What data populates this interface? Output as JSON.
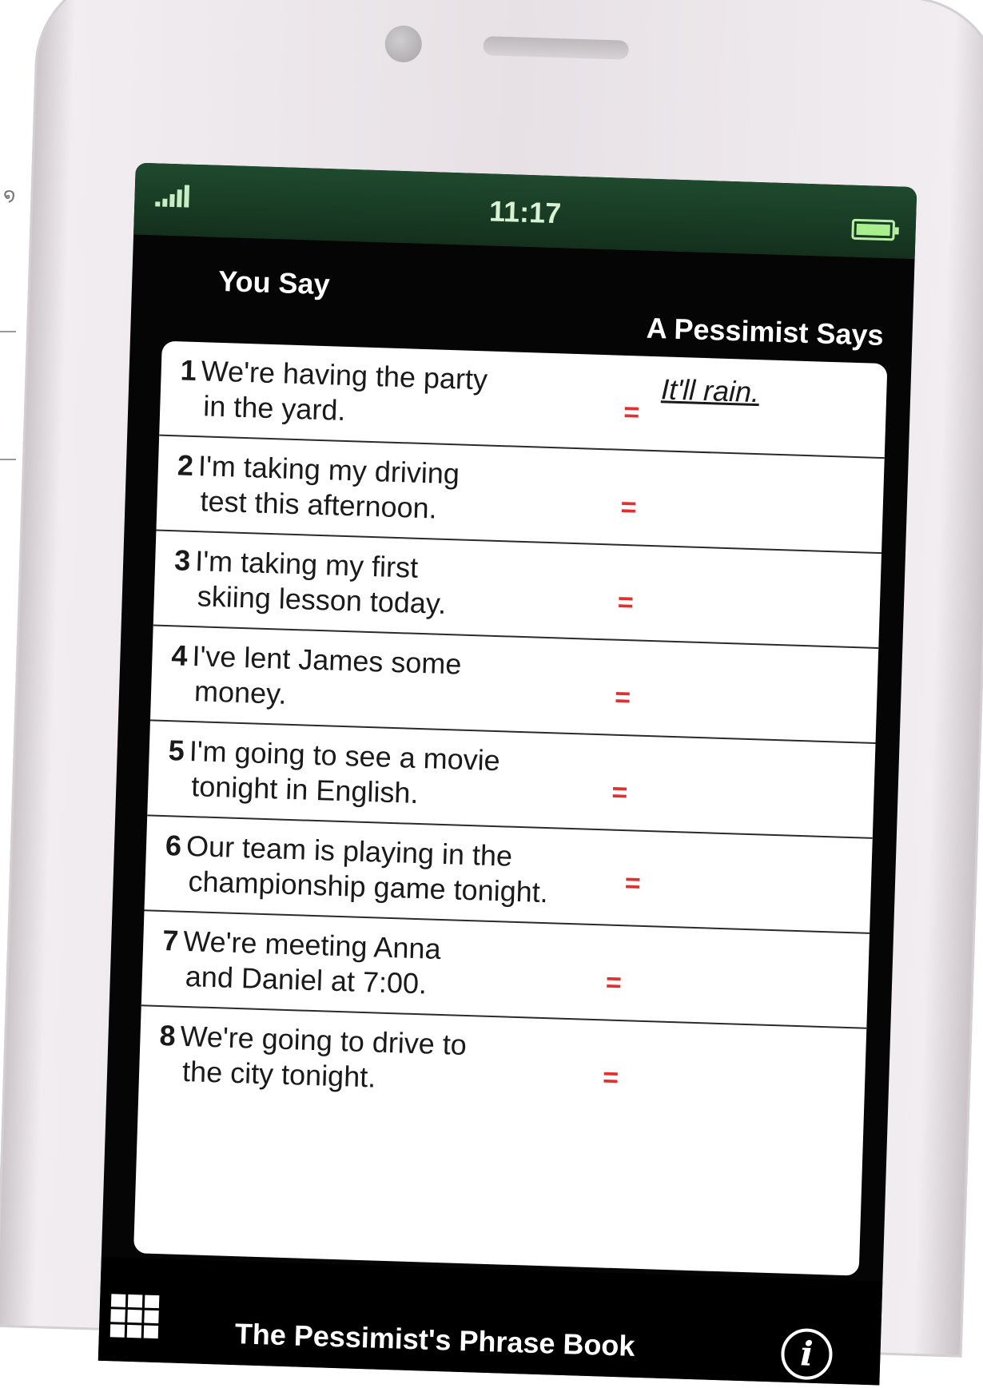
{
  "status_bar": {
    "time": "11:17",
    "signal_icon": "signal-bars-icon",
    "battery_icon": "battery-icon"
  },
  "columns": {
    "left_header": "You Say",
    "right_header": "A Pessimist Says"
  },
  "rows": [
    {
      "num": "1",
      "line1": "We're having the party",
      "line2": "in the yard.",
      "equals": "=",
      "answer": "It'll rain."
    },
    {
      "num": "2",
      "line1": "I'm taking my driving",
      "line2": "test this afternoon.",
      "equals": "=",
      "answer": ""
    },
    {
      "num": "3",
      "line1": "I'm taking my first",
      "line2": "skiing lesson today.",
      "equals": "=",
      "answer": ""
    },
    {
      "num": "4",
      "line1": "I've lent James some",
      "line2": "money.",
      "equals": "=",
      "answer": ""
    },
    {
      "num": "5",
      "line1": "I'm going to see a movie",
      "line2": "tonight in English.",
      "equals": "=",
      "answer": ""
    },
    {
      "num": "6",
      "line1": "Our team is playing in the",
      "line2": "championship game tonight.",
      "equals": "=",
      "answer": ""
    },
    {
      "num": "7",
      "line1": "We're meeting Anna",
      "line2": "and Daniel at 7:00.",
      "equals": "=",
      "answer": ""
    },
    {
      "num": "8",
      "line1": "We're going to drive to",
      "line2": "the city tonight.",
      "equals": "=",
      "answer": ""
    }
  ],
  "bottom_bar": {
    "title": "The Pessimist's Phrase Book",
    "menu_icon": "grid-menu-icon",
    "info_icon": "info-icon",
    "info_glyph": "i"
  },
  "colors": {
    "status_bar_green": "#1f4a2e",
    "equals_red": "#e2302f",
    "screen_black": "#050505"
  }
}
